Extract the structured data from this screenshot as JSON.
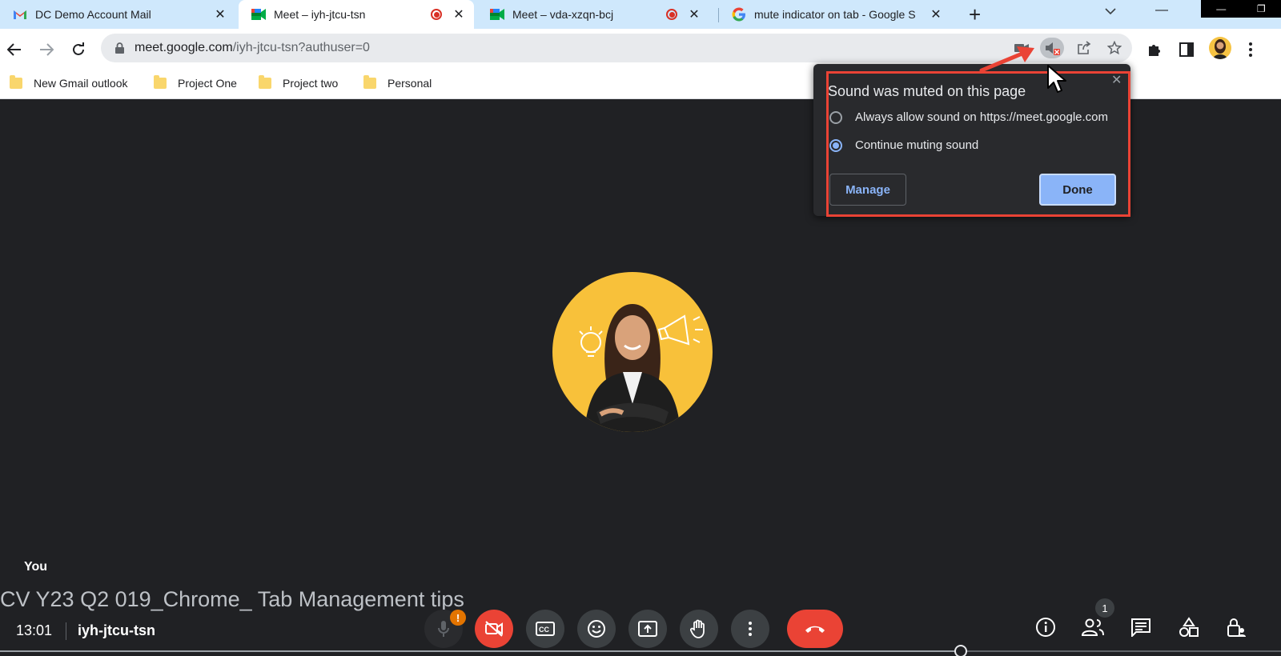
{
  "tabs": [
    {
      "title": "DC Demo Account Mail",
      "favicon": "gmail-icon",
      "recording": false,
      "active": false
    },
    {
      "title": "Meet – iyh-jtcu-tsn",
      "favicon": "meet-icon",
      "recording": true,
      "active": true
    },
    {
      "title": "Meet – vda-xzqn-bcj",
      "favicon": "meet-icon",
      "recording": true,
      "active": false
    },
    {
      "title": "mute indicator on tab - Google S",
      "favicon": "google-icon",
      "recording": false,
      "active": false
    }
  ],
  "address_bar": {
    "host": "meet.google.com",
    "path": "/iyh-jtcu-tsn?authuser=0"
  },
  "bookmarks": [
    {
      "label": "New Gmail outlook"
    },
    {
      "label": "Project One"
    },
    {
      "label": "Project two"
    },
    {
      "label": "Personal"
    }
  ],
  "popup": {
    "title": "Sound was muted on this page",
    "options": [
      {
        "label": "Always allow sound on https://meet.google.com",
        "checked": false
      },
      {
        "label": "Continue muting sound",
        "checked": true
      }
    ],
    "manage_label": "Manage",
    "done_label": "Done"
  },
  "meet": {
    "self_label": "You",
    "time": "13:01",
    "meeting_code": "iyh-jtcu-tsn",
    "participant_count": "1",
    "warning_badge": "!",
    "video_progress": 0.75
  },
  "video_title": "CV Y23 Q2 019_Chrome_ Tab Management tips",
  "colors": {
    "tabstrip": "#cfe8fc",
    "accent_blue": "#8ab4f8",
    "danger_red": "#ea4335",
    "meet_bg": "#202124",
    "avatar_bg": "#f8c13a"
  }
}
